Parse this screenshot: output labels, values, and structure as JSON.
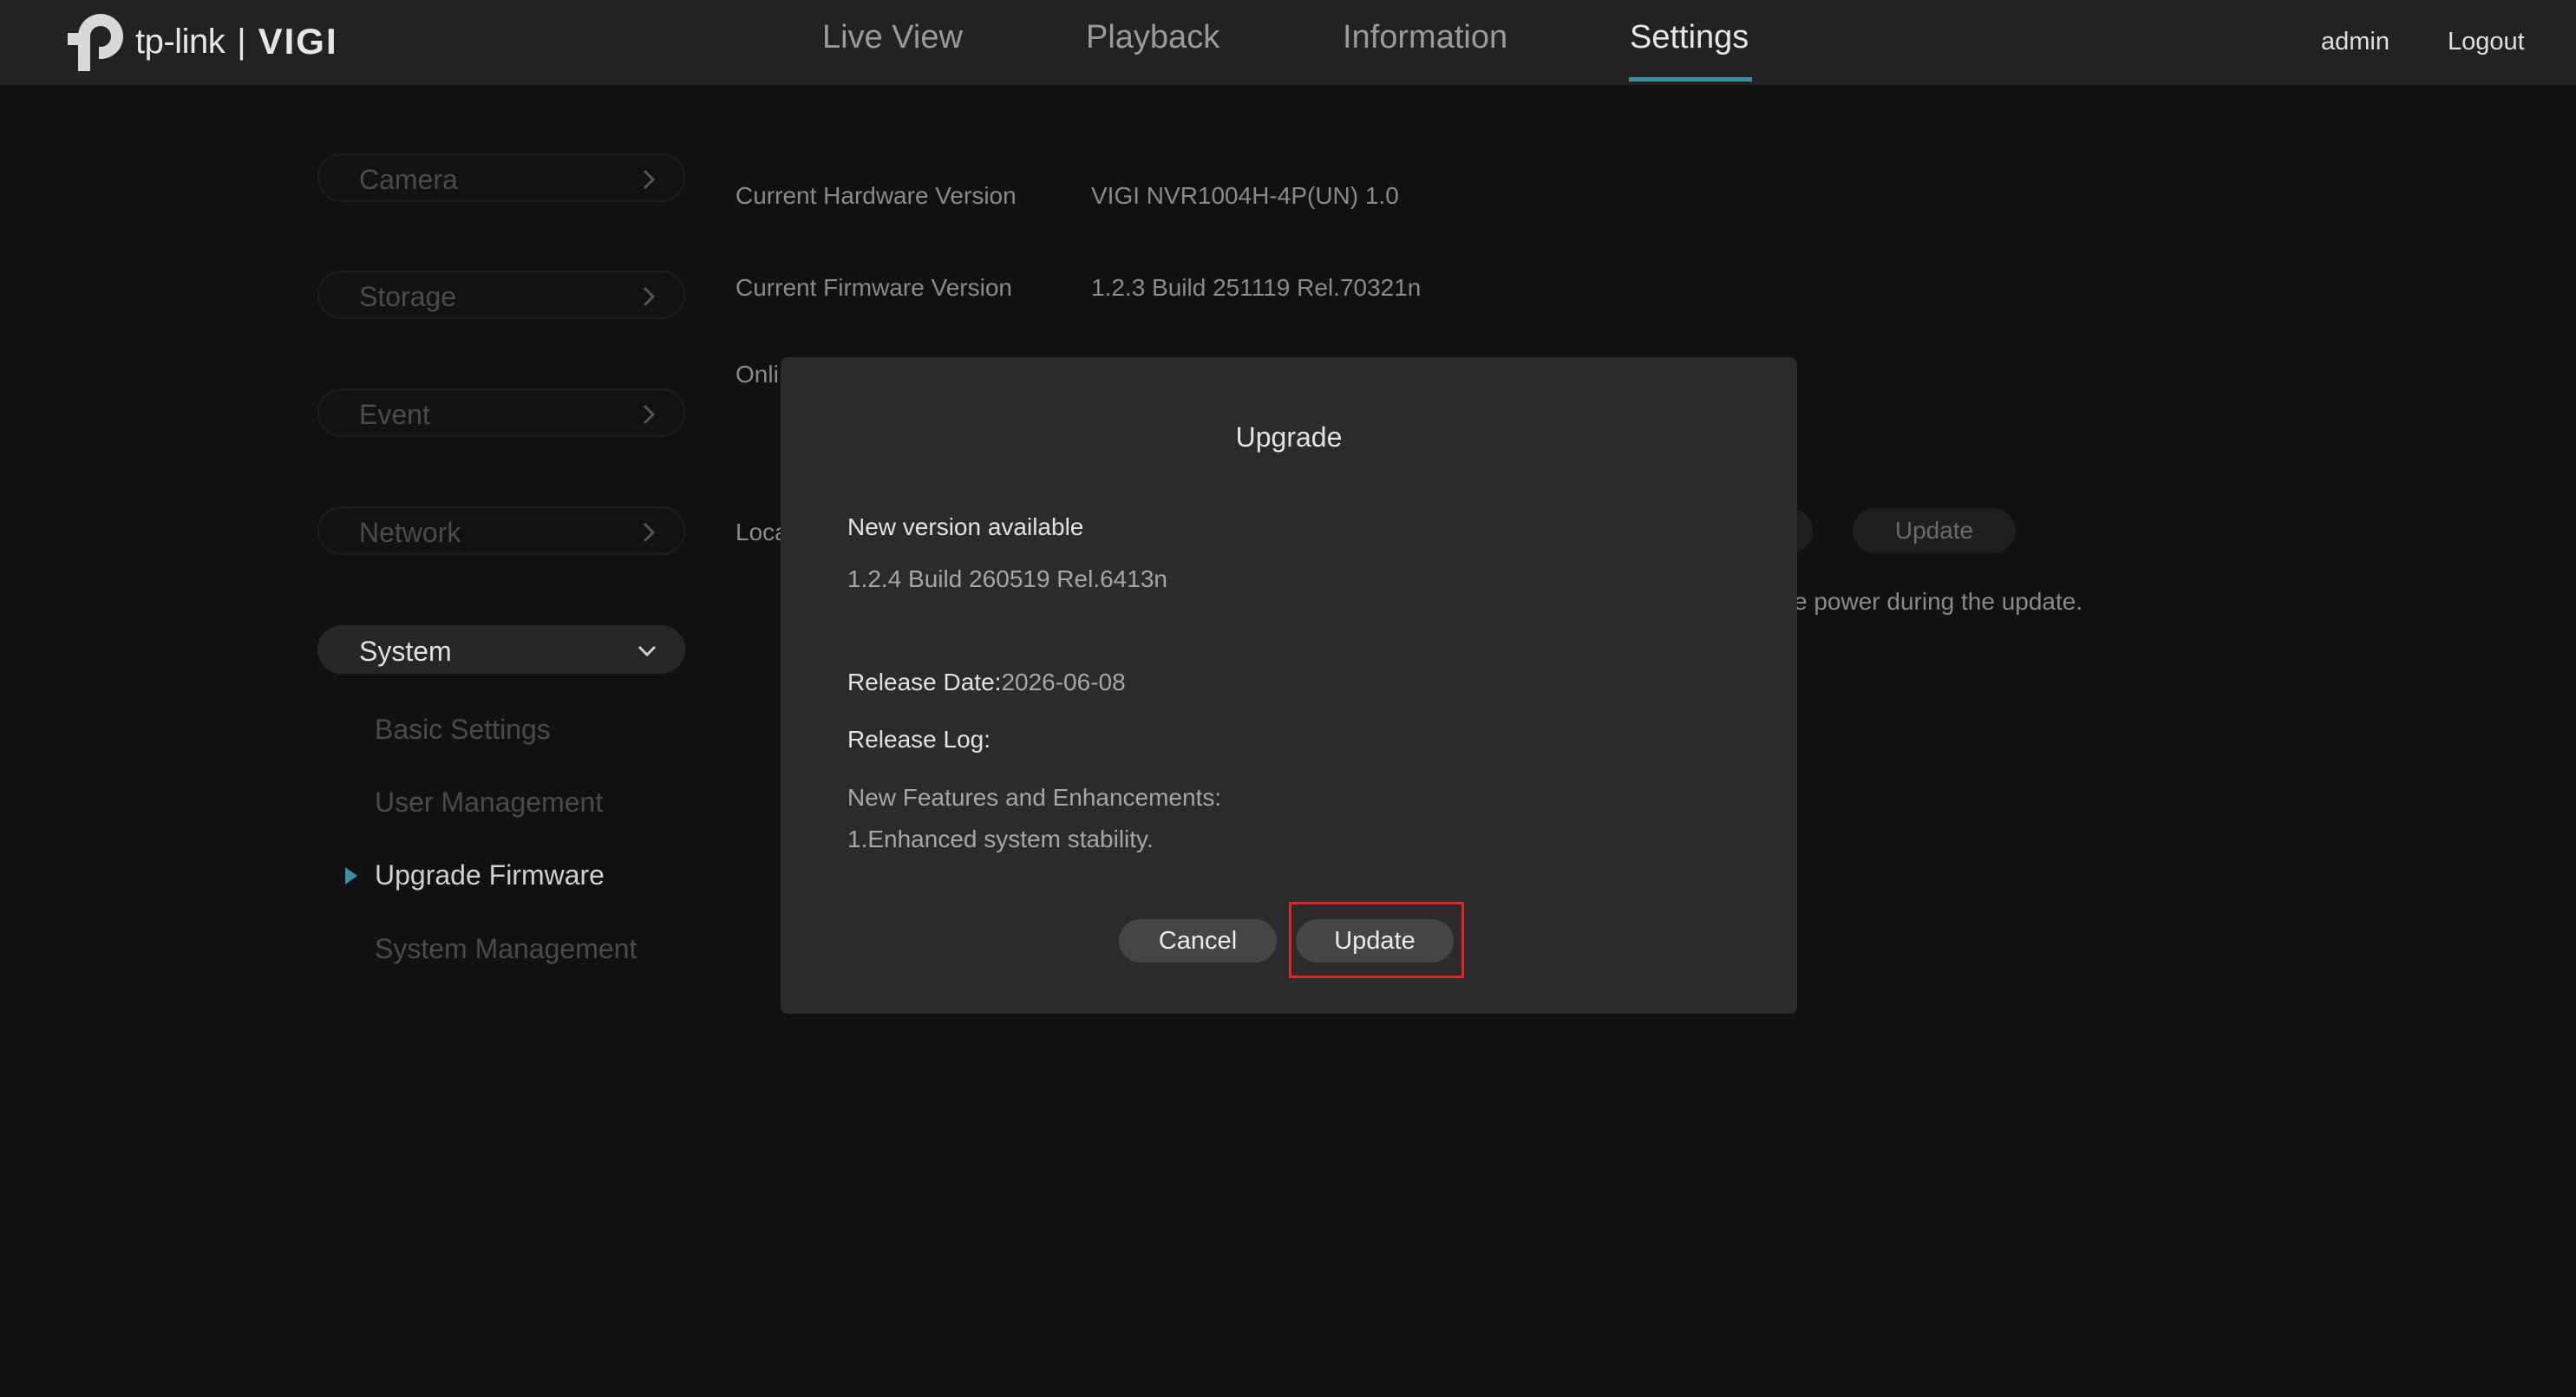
{
  "brand": {
    "logo_text": "tp-link",
    "separator": "|",
    "product": "VIGI"
  },
  "nav": {
    "tabs": [
      {
        "label": "Live View"
      },
      {
        "label": "Playback"
      },
      {
        "label": "Information"
      },
      {
        "label": "Settings",
        "active": true
      }
    ],
    "user": "admin",
    "logout": "Logout"
  },
  "sidebar": {
    "groups": [
      {
        "label": "Camera"
      },
      {
        "label": "Storage"
      },
      {
        "label": "Event"
      },
      {
        "label": "Network"
      },
      {
        "label": "System",
        "expanded": true
      }
    ],
    "system_items": [
      {
        "label": "Basic Settings"
      },
      {
        "label": "User Management"
      },
      {
        "label": "Upgrade Firmware",
        "active": true
      },
      {
        "label": "System Management"
      }
    ]
  },
  "content": {
    "hardware_label": "Current Hardware Version",
    "hardware_value": "VIGI NVR1004H-4P(UN) 1.0",
    "firmware_label": "Current Firmware Version",
    "firmware_value": "1.2.3 Build 251119 Rel.70321n",
    "online_label_partial": "Onli",
    "local_label_partial": "Loca",
    "update_button": "Update",
    "power_note_partial": "e power during the update."
  },
  "modal": {
    "title": "Upgrade",
    "new_version_label": "New version available",
    "new_version_value": "1.2.4 Build 260519 Rel.6413n",
    "release_date_label": "Release Date:",
    "release_date_value": "2026-06-08",
    "release_log_label": "Release Log:",
    "release_log_lines": [
      "New Features and Enhancements:",
      "1.Enhanced system stability."
    ],
    "cancel_button": "Cancel",
    "update_button": "Update"
  },
  "colors": {
    "accent": "#3a8fa5",
    "highlight": "#e0242b",
    "background": "#111111",
    "topbar": "#222222",
    "modal": "#2b2b2b"
  }
}
